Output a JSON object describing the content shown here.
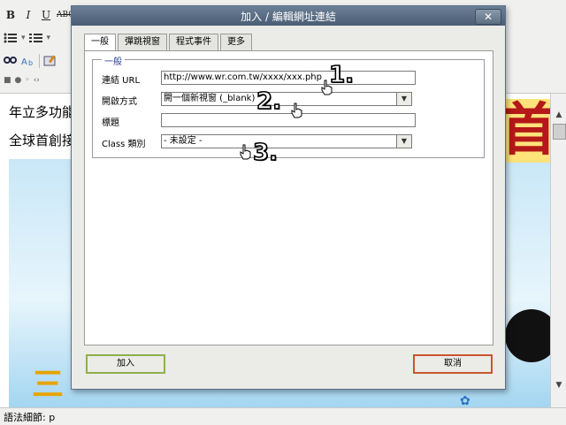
{
  "editor": {
    "toolbar": {
      "bold": "B",
      "italic": "I",
      "underline": "U",
      "strikethrough": "ABC"
    },
    "content_lines": [
      "年立多功能",
      "全球首創接"
    ],
    "image_text_top": "首",
    "image_text_bottom": "三"
  },
  "status_bar": {
    "path": "語法細節: p"
  },
  "dialog": {
    "title": "加入 / 編輯網址連結",
    "close_label": "✕",
    "tabs": [
      {
        "label": "一般",
        "active": true
      },
      {
        "label": "彈跳視窗",
        "active": false
      },
      {
        "label": "程式事件",
        "active": false
      },
      {
        "label": "更多",
        "active": false
      }
    ],
    "fieldset_legend": "一般",
    "fields": {
      "url": {
        "label": "連結 URL",
        "value": "http://www.wr.com.tw/xxxx/xxx.php"
      },
      "target": {
        "label": "開啟方式",
        "value": "開一個新視窗 (_blank)"
      },
      "title": {
        "label": "標題",
        "value": ""
      },
      "class": {
        "label": "Class 類別",
        "value": "- 未設定 -"
      }
    },
    "buttons": {
      "insert": "加入",
      "cancel": "取消"
    }
  },
  "annotations": {
    "step1": "1.",
    "step2": "2.",
    "step3": "3."
  },
  "colors": {
    "insert_border": "#8fb04a",
    "cancel_border": "#c9562c",
    "titlebar": "#4a5d74",
    "legend": "#2a3f9a"
  }
}
